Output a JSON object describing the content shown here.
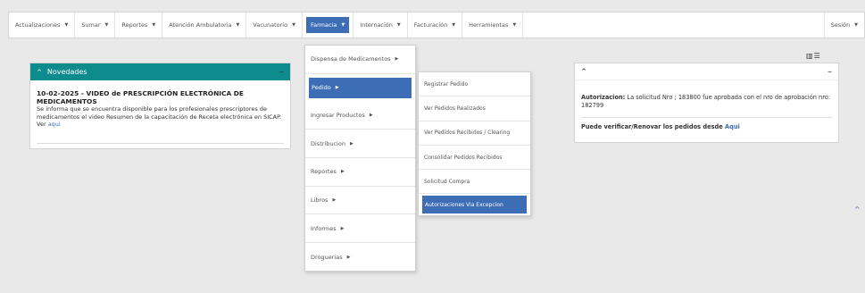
{
  "nav": {
    "items": [
      {
        "label": "Actualizaciones"
      },
      {
        "label": "Sumar"
      },
      {
        "label": "Reportes"
      },
      {
        "label": "Atención Ambulatoria"
      },
      {
        "label": "Vacunatorio"
      },
      {
        "label": "Farmacia",
        "active": true
      },
      {
        "label": "Internación"
      },
      {
        "label": "Facturación"
      },
      {
        "label": "Herramientas"
      }
    ],
    "session": "Sesión",
    "accent": "#3d6db5"
  },
  "novedades": {
    "header": "Novedades",
    "title": "10-02-2025 - VIDEO de PRESCRIPCIÓN ELECTRÓNICA DE MEDICAMENTOS",
    "text": "Se informa que se encuentra disponible para los profesionales prescriptores de medicamentos el video Resumen de la capacitación de Receta electrónica en SICAP. Ver",
    "link": "aqui",
    "header_color": "#0e8b8d"
  },
  "autorizacion": {
    "label": "Autorizacion:",
    "message": "La solicitud Nro ; 183800 fue aprobada con el nro de aprobación nro: 182799",
    "renew_text": "Puede verificar/Renovar los pedidos desde",
    "renew_link": "Aqui"
  },
  "farmacia_menu": {
    "items": [
      {
        "label": "Dispensa de Medicamentos"
      },
      {
        "label": "Pedido",
        "active": true
      },
      {
        "label": "Ingresar Productos"
      },
      {
        "label": "Distribucion"
      },
      {
        "label": "Reportes"
      },
      {
        "label": "Libros"
      },
      {
        "label": "Informes"
      },
      {
        "label": "Droguerias"
      }
    ]
  },
  "pedido_menu": {
    "items": [
      {
        "label": "Registrar Pedido"
      },
      {
        "label": "Ver Pedidos Realizados"
      },
      {
        "label": "Ver Pedidos Recibidos / Clearing"
      },
      {
        "label": "Consolidar Pedidos Recibidos"
      },
      {
        "label": "Solicitud Compra"
      },
      {
        "label": "Autorizaciones Via Excepcion",
        "active": true
      }
    ]
  }
}
